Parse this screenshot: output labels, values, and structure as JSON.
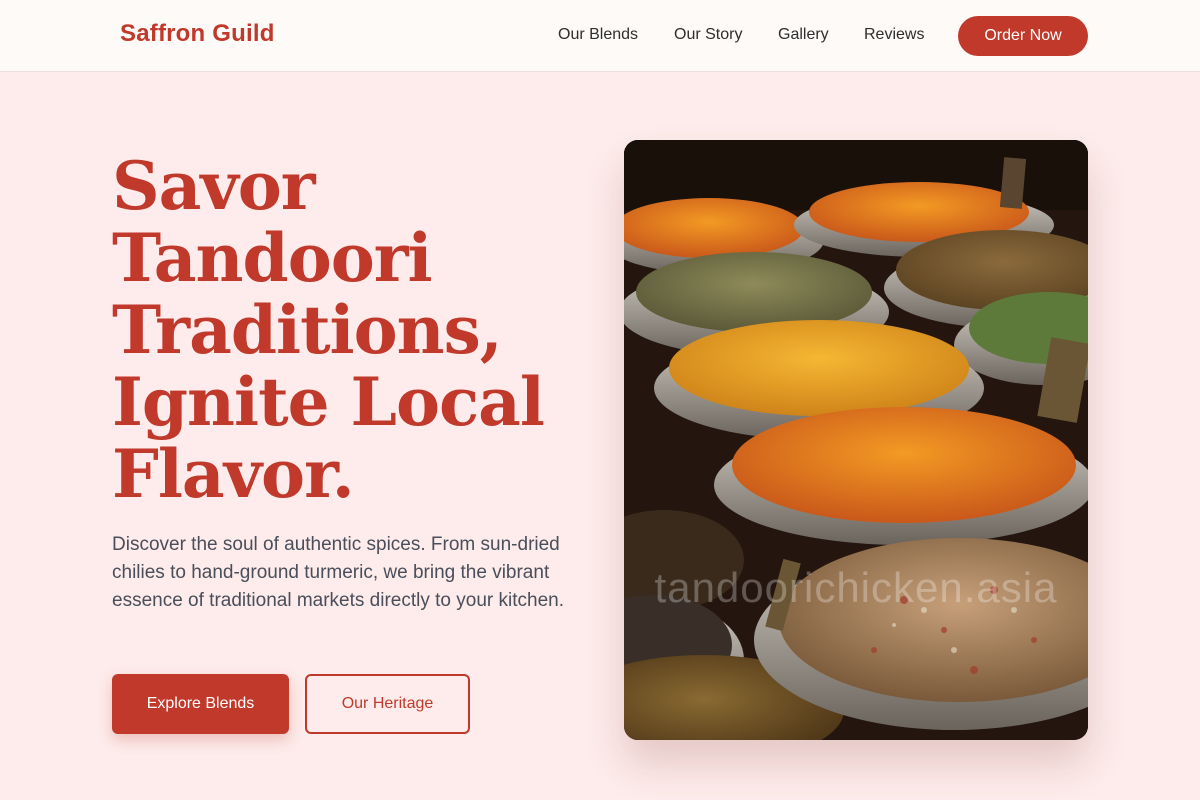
{
  "header": {
    "brand": "Saffron Guild",
    "nav": [
      {
        "label": "Our Blends"
      },
      {
        "label": "Our Story"
      },
      {
        "label": "Gallery"
      },
      {
        "label": "Reviews"
      }
    ],
    "order_label": "Order Now"
  },
  "hero": {
    "title": "Savor Tandoori Traditions, Ignite Local Flavor.",
    "description": "Discover the soul of authentic spices. From sun-dried chilies to hand-ground turmeric, we bring the vibrant essence of traditional markets directly to your kitchen.",
    "primary_button": "Explore Blends",
    "secondary_button": "Our Heritage",
    "image_watermark": "tandoorichicken.asia"
  },
  "colors": {
    "accent": "#c0392b",
    "background": "#fdeceb",
    "header_bg": "#fdfaf8",
    "body_text": "#4a4e5a"
  }
}
